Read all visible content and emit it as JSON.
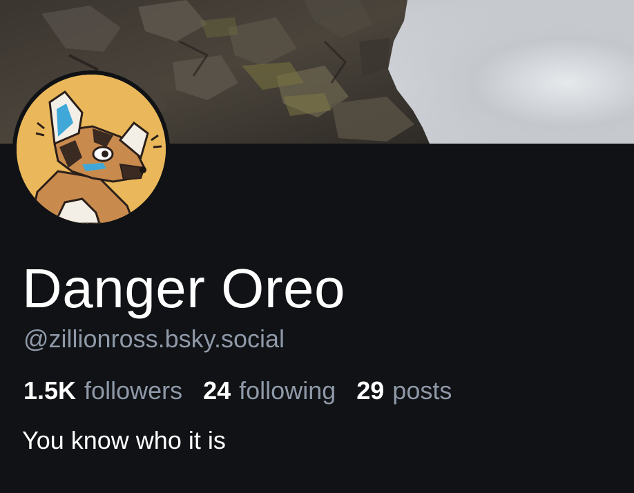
{
  "profile": {
    "banner_icon": "landscape-rock-cliff",
    "avatar_icon": "wild-dog-character",
    "display_name": "Danger Oreo",
    "handle": "@zillionross.bsky.social",
    "bio": "You know who it is",
    "stats": {
      "followers": {
        "count": "1.5K",
        "label": "followers"
      },
      "following": {
        "count": "24",
        "label": "following"
      },
      "posts": {
        "count": "29",
        "label": "posts"
      }
    }
  },
  "colors": {
    "background": "#101215",
    "text_primary": "#ffffff",
    "text_secondary": "#8f99a8",
    "avatar_bg": "#eab85a"
  }
}
